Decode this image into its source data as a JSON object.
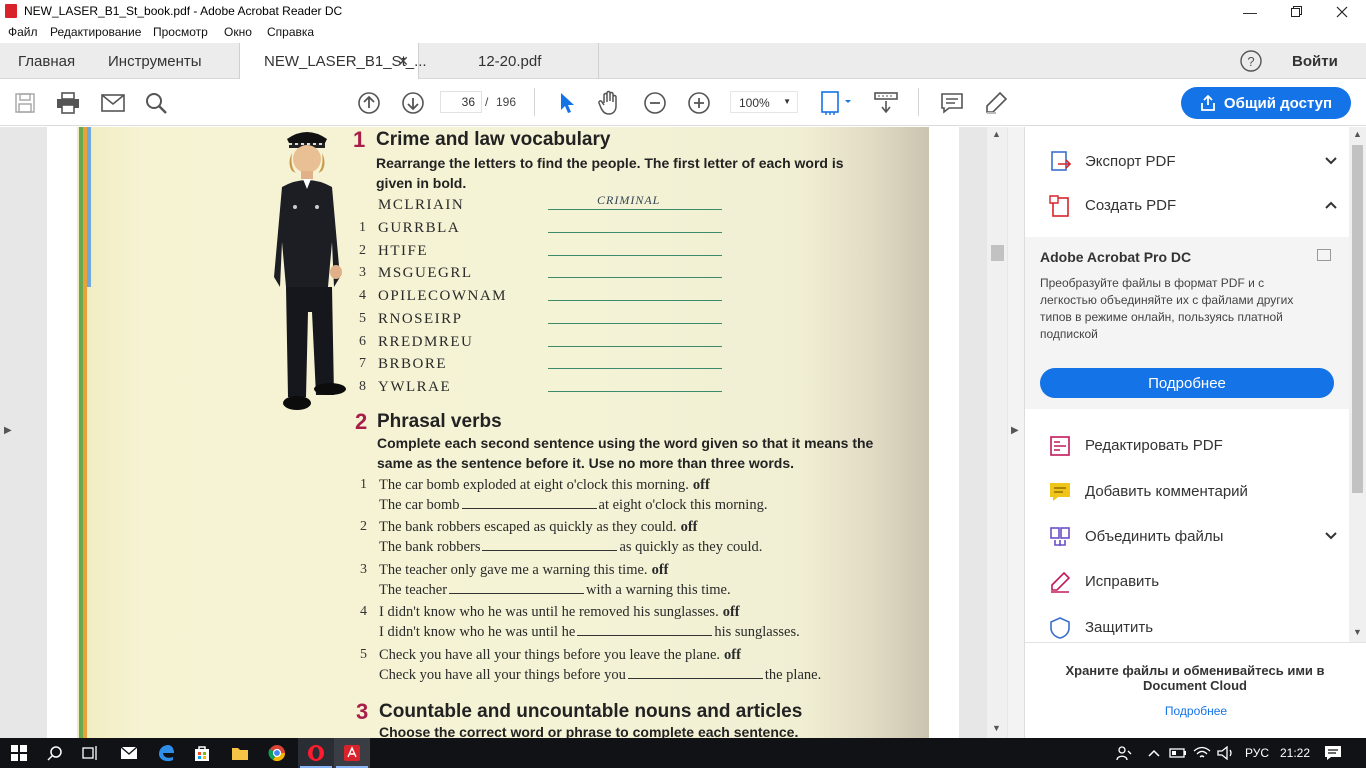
{
  "window": {
    "title": "NEW_LASER_B1_St_book.pdf - Adobe Acrobat Reader DC"
  },
  "menu": [
    "Файл",
    "Редактирование",
    "Просмотр",
    "Окно",
    "Справка"
  ],
  "tabs": {
    "home": "Главная",
    "tools": "Инструменты",
    "doc1": "NEW_LASER_B1_St_...",
    "doc2": "12-20.pdf",
    "signin": "Войти"
  },
  "toolbar": {
    "page_current": "36",
    "page_sep": "/",
    "page_total": "196",
    "zoom": "100%",
    "share": "Общий доступ"
  },
  "book": {
    "s1": {
      "num": "1",
      "title": "Crime and law vocabulary",
      "instr": "Rearrange the letters to find the people. The first letter of each word is given in bold.",
      "example": {
        "num": "",
        "word": "MCLRIAIN",
        "answer": "CRIMINAL"
      },
      "items": [
        {
          "num": "1",
          "word": "GURRBLA"
        },
        {
          "num": "2",
          "word": "HTIFE"
        },
        {
          "num": "3",
          "word": "MSGUEGRL"
        },
        {
          "num": "4",
          "word": "OPILECOWNAM"
        },
        {
          "num": "5",
          "word": "RNOSEIRP"
        },
        {
          "num": "6",
          "word": "RREDMREU"
        },
        {
          "num": "7",
          "word": "BRBORE"
        },
        {
          "num": "8",
          "word": "YWLRAE"
        }
      ]
    },
    "s2": {
      "num": "2",
      "title": "Phrasal verbs",
      "instr": "Complete each second sentence using the word given so that it means the same as the sentence before it. Use no more than three words.",
      "items": [
        {
          "num": "1",
          "a": "The car bomb exploded at eight o'clock this morning.",
          "key": "off",
          "b1": "The car bomb",
          "b2": "at eight o'clock this morning."
        },
        {
          "num": "2",
          "a": "The bank robbers escaped as quickly as they could.",
          "key": "off",
          "b1": "The bank robbers",
          "b2": "as quickly as they could."
        },
        {
          "num": "3",
          "a": "The teacher only gave me a warning this time.",
          "key": "off",
          "b1": "The teacher",
          "b2": "with a warning this time."
        },
        {
          "num": "4",
          "a": "I didn't know who he was until he removed his sunglasses.",
          "key": "off",
          "b1": "I didn't know who he was until he",
          "b2": "his sunglasses."
        },
        {
          "num": "5",
          "a": "Check you have all your things before you leave the plane.",
          "key": "off",
          "b1": "Check you have all your things before you",
          "b2": "the plane."
        }
      ]
    },
    "s3": {
      "num": "3",
      "title": "Countable and uncountable nouns and articles",
      "instr": "Choose the correct word or phrase to complete each sentence."
    }
  },
  "panel": {
    "export": "Экспорт PDF",
    "create": "Создать PDF",
    "promo_title": "Adobe Acrobat Pro DC",
    "promo_text": "Преобразуйте файлы в формат PDF и с легкостью объединяйте их с файлами других типов в режиме онлайн, пользуясь платной подпиской",
    "promo_btn": "Подробнее",
    "edit": "Редактировать PDF",
    "comment": "Добавить комментарий",
    "combine": "Объединить файлы",
    "fill": "Исправить",
    "protect": "Защитить",
    "cloud_text": "Храните файлы и обменивайтесь ими в Document Cloud",
    "cloud_link": "Подробнее"
  },
  "taskbar": {
    "lang": "РУС",
    "time": "21:22"
  },
  "colors": {
    "accent": "#1473e6",
    "section_num": "#a81e49",
    "pdf_red": "#d8232a"
  }
}
